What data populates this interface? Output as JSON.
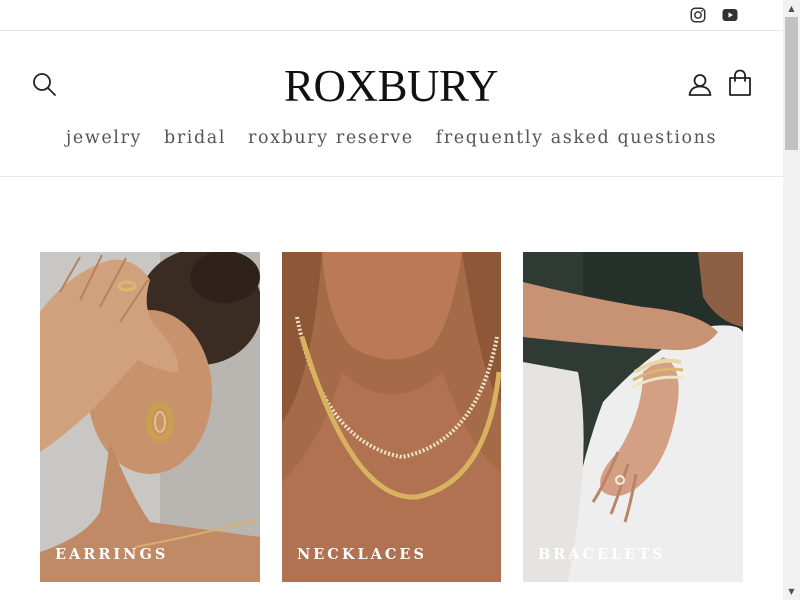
{
  "topbar": {
    "social": [
      {
        "icon": "instagram-icon"
      },
      {
        "icon": "youtube-icon"
      }
    ]
  },
  "header": {
    "logo": "ROXBURY",
    "icons": [
      "search-icon",
      "account-icon",
      "cart-icon"
    ],
    "nav": [
      {
        "label": "jewelry"
      },
      {
        "label": "bridal"
      },
      {
        "label": "roxbury reserve"
      },
      {
        "label": "frequently asked questions"
      }
    ]
  },
  "collections": [
    {
      "label": "EARRINGS"
    },
    {
      "label": "NECKLACES"
    },
    {
      "label": "BRACELETS"
    }
  ],
  "colors": {
    "text": "#1a1a1a",
    "nav_text": "#555555",
    "divider": "#e8e8e8",
    "tile_label": "#ffffff"
  },
  "scrollbar": {
    "up_arrow": "▲",
    "down_arrow": "▼"
  }
}
